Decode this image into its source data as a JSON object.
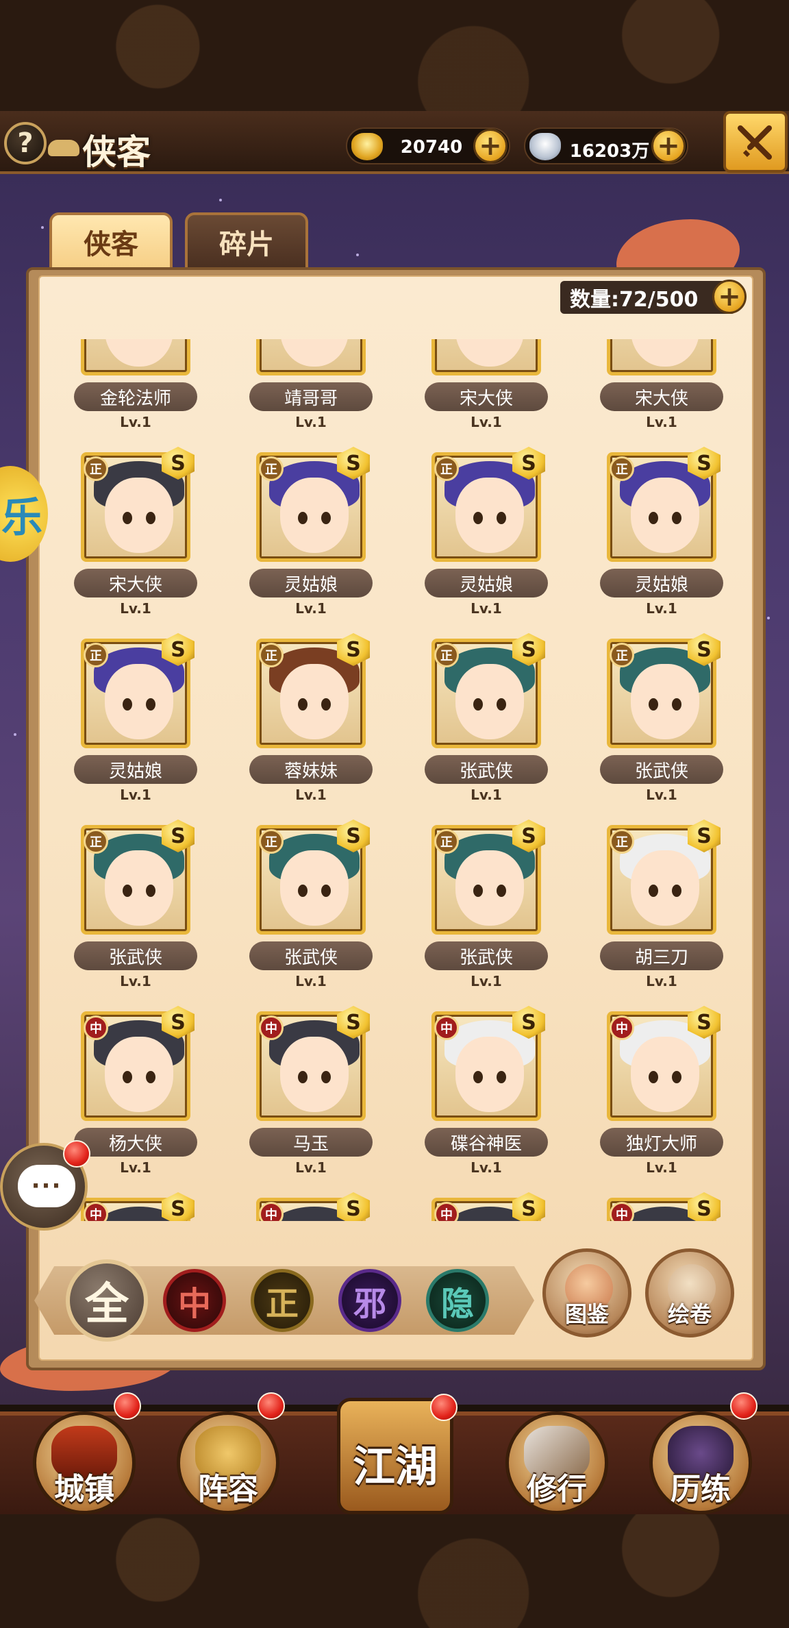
{
  "header": {
    "title": "侠客",
    "help_label": "?",
    "gold": "20740",
    "silver": "16203万",
    "plus": "+",
    "close_icon": "crossed-swords-icon"
  },
  "tabs": [
    {
      "label": "侠客",
      "active": true
    },
    {
      "label": "碎片",
      "active": false
    }
  ],
  "count": {
    "label": "数量:72/500"
  },
  "heroes": [
    {
      "name": "金轮法师",
      "level": "Lv.1",
      "faction": "",
      "rank": ""
    },
    {
      "name": "靖哥哥",
      "level": "Lv.1",
      "faction": "",
      "rank": ""
    },
    {
      "name": "宋大侠",
      "level": "Lv.1",
      "faction": "",
      "rank": ""
    },
    {
      "name": "宋大侠",
      "level": "Lv.1",
      "faction": "",
      "rank": ""
    },
    {
      "name": "宋大侠",
      "level": "Lv.1",
      "faction": "正",
      "rank": "S"
    },
    {
      "name": "灵姑娘",
      "level": "Lv.1",
      "faction": "正",
      "rank": "S"
    },
    {
      "name": "灵姑娘",
      "level": "Lv.1",
      "faction": "正",
      "rank": "S"
    },
    {
      "name": "灵姑娘",
      "level": "Lv.1",
      "faction": "正",
      "rank": "S"
    },
    {
      "name": "灵姑娘",
      "level": "Lv.1",
      "faction": "正",
      "rank": "S"
    },
    {
      "name": "蓉妹妹",
      "level": "Lv.1",
      "faction": "正",
      "rank": "S"
    },
    {
      "name": "张武侠",
      "level": "Lv.1",
      "faction": "正",
      "rank": "S"
    },
    {
      "name": "张武侠",
      "level": "Lv.1",
      "faction": "正",
      "rank": "S"
    },
    {
      "name": "张武侠",
      "level": "Lv.1",
      "faction": "正",
      "rank": "S"
    },
    {
      "name": "张武侠",
      "level": "Lv.1",
      "faction": "正",
      "rank": "S"
    },
    {
      "name": "张武侠",
      "level": "Lv.1",
      "faction": "正",
      "rank": "S"
    },
    {
      "name": "胡三刀",
      "level": "Lv.1",
      "faction": "正",
      "rank": "S"
    },
    {
      "name": "杨大侠",
      "level": "Lv.1",
      "faction": "中",
      "rank": "S"
    },
    {
      "name": "马玉",
      "level": "Lv.1",
      "faction": "中",
      "rank": "S"
    },
    {
      "name": "碟谷神医",
      "level": "Lv.1",
      "faction": "中",
      "rank": "S"
    },
    {
      "name": "独灯大师",
      "level": "Lv.1",
      "faction": "中",
      "rank": "S"
    },
    {
      "name": "",
      "level": "",
      "faction": "中",
      "rank": "S"
    },
    {
      "name": "",
      "level": "",
      "faction": "中",
      "rank": "S"
    },
    {
      "name": "",
      "level": "",
      "faction": "中",
      "rank": "S"
    },
    {
      "name": "",
      "level": "",
      "faction": "中",
      "rank": "S"
    }
  ],
  "filters": [
    {
      "key": "all",
      "label": "全"
    },
    {
      "key": "zhong",
      "label": "中"
    },
    {
      "key": "zheng",
      "label": "正"
    },
    {
      "key": "xie",
      "label": "邪"
    },
    {
      "key": "yin",
      "label": "隐"
    }
  ],
  "side_buttons": {
    "atlas": "图鉴",
    "scroll": "绘卷"
  },
  "chat": {
    "label": "···"
  },
  "nav": {
    "city": "城镇",
    "team": "阵容",
    "jianghu": "江湖",
    "practice": "修行",
    "trial": "历练"
  },
  "side_yellow": "乐",
  "colors": {
    "accent_gold": "#e9b73b",
    "panel": "#fbead0",
    "notify_red": "#e2231a"
  }
}
